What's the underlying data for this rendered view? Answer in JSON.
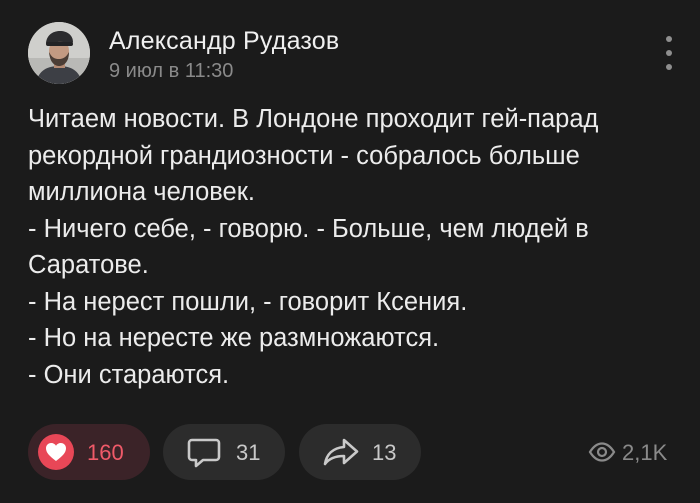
{
  "post": {
    "author": {
      "name": "Александр Рудазов",
      "time": "9 июл в 11:30",
      "avatar_icon": "user-photo"
    },
    "menu_icon": "more-vertical-icon",
    "text_lines": [
      "Читаем новости. В Лондоне проходит гей-парад",
      "рекордной грандиозности - собралось больше",
      "миллиона человек.",
      "- Ничего себе, - говорю. - Больше, чем людей в",
      "Саратове.",
      "- На нерест пошли, - говорит Ксения.",
      "- Но на нересте же размножаются.",
      "- Они стараются."
    ],
    "actions": {
      "likes": {
        "count": "160",
        "icon": "heart-icon",
        "color": "#e84757"
      },
      "comments": {
        "count": "31",
        "icon": "comment-icon"
      },
      "shares": {
        "count": "13",
        "icon": "share-arrow-icon"
      },
      "views": {
        "count": "2,1K",
        "icon": "eye-icon"
      }
    }
  },
  "colors": {
    "background": "#1b1b1b",
    "pill": "#2c2c2c",
    "like_pill": "#3b2328",
    "text": "#ececec",
    "muted": "#8a8a8a"
  }
}
